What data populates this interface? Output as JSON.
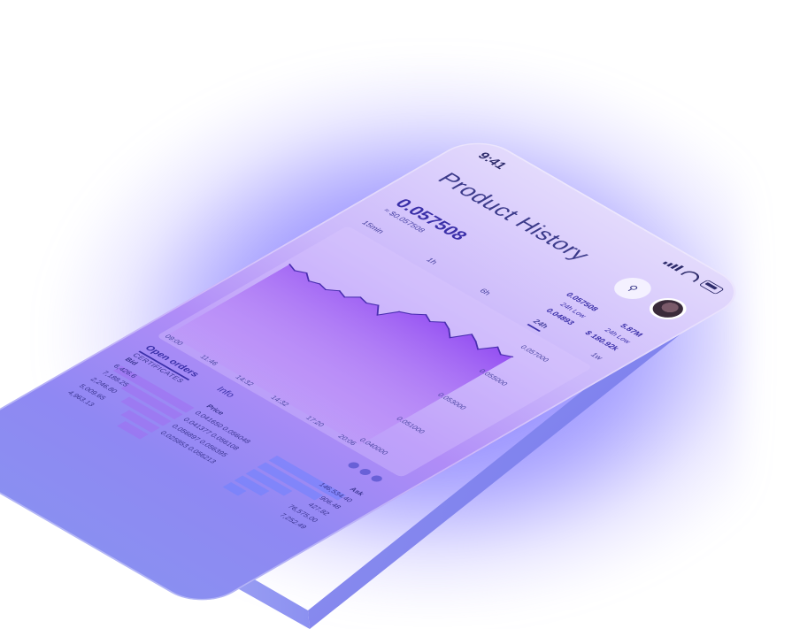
{
  "status": {
    "time": "9:41"
  },
  "header": {
    "title": "Product History",
    "search_icon": "search-icon",
    "avatar": "user-avatar"
  },
  "price": {
    "value": "0.057508",
    "usd": "≈ $0.057508"
  },
  "stats": {
    "top_value": "0.057508",
    "volume": "5.87M",
    "low_label": "24h Low",
    "low_value": "0.04893",
    "low_label_2": "24h Low",
    "low_usd": "$ 180.92k"
  },
  "timeframes": [
    "15min",
    "1h",
    "6h",
    "24h",
    "1w"
  ],
  "active_timeframe": "24h",
  "chart_data": {
    "type": "area",
    "x": [
      "09:00",
      "11:46",
      "14:32",
      "14:32",
      "17:20",
      "20:06"
    ],
    "y_ticks": [
      "0.057000",
      "0.055000",
      "0.053000",
      "0.051000",
      "0.040000"
    ],
    "line_series": [
      0.0524,
      0.0521,
      0.0525,
      0.0519,
      0.0522,
      0.052,
      0.0526,
      0.0523,
      0.0531,
      0.0529,
      0.0533,
      0.0524,
      0.0538,
      0.0542,
      0.0549,
      0.0545,
      0.0552,
      0.0548,
      0.0541,
      0.0555,
      0.0551,
      0.0545,
      0.0557,
      0.0552,
      0.0556
    ],
    "ylim": [
      0.04,
      0.058
    ]
  },
  "orders": {
    "tabs": [
      "Open orders",
      "Info"
    ],
    "certificates": "CERTIFICATES",
    "bid_header": "Bid",
    "price_header": "Price",
    "ask_header": "Ask",
    "bids": [
      "6,426.6",
      "7,188.25",
      "2,246.80",
      "5,009.65",
      "4,963.13"
    ],
    "bid_prices": [
      "0.041650",
      "0.041377",
      "0.056897",
      "0.025853"
    ],
    "ask_prices": [
      "0.056048",
      "0.056108",
      "0.056395",
      "0.056213"
    ],
    "asks": [
      "146,534.40",
      "906.48",
      "427.82",
      "76,575.00",
      "7,252.49"
    ],
    "bid_fill": [
      0.95,
      0.7,
      0.55,
      0.4,
      0.3
    ],
    "ask_fill": [
      0.9,
      0.75,
      0.5,
      0.35,
      0.2
    ]
  }
}
